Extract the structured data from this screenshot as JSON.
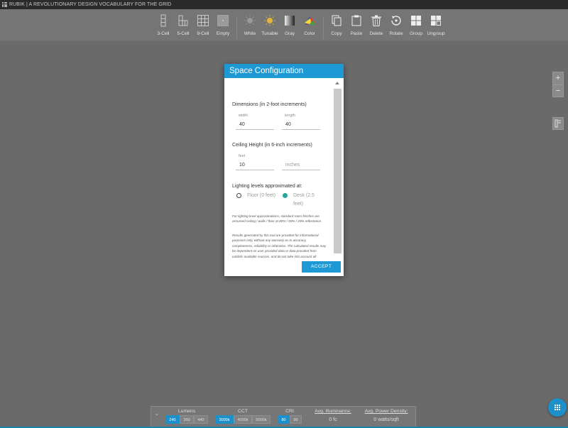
{
  "app": {
    "title": "RUBIK | A REVOLUTIONARY DESIGN VOCABULARY FOR THE GRID"
  },
  "toolbar": {
    "layouts": [
      "3-Cell",
      "5-Cell",
      "9-Cell",
      "Empty"
    ],
    "lighting": [
      "White",
      "Tunable",
      "Gray",
      "Color"
    ],
    "actions": [
      "Copy",
      "Paste",
      "Delete",
      "Rotate",
      "Group",
      "Ungroup"
    ]
  },
  "zoom": {
    "in": "+",
    "out": "−"
  },
  "dialog": {
    "title": "Space Configuration",
    "dimensions": {
      "heading": "Dimensions (in 2-foot increments)",
      "width_label": "width",
      "width_value": "40",
      "length_label": "length",
      "length_value": "40"
    },
    "ceiling": {
      "heading": "Ceiling Height (in 6-inch increments)",
      "feet_label": "feet",
      "feet_value": "10",
      "inches_placeholder": "inches"
    },
    "lighting": {
      "heading": "Lighting levels approximated at:",
      "floor_label": "Floor (0 feet)",
      "desk_label": "Desk (2.5 feet)",
      "selected": "desk"
    },
    "note1": "For lighting level approximations, standard room finishes are assumed ceiling / walls / floor at 80% / 50% / 20% reflectance.",
    "note2": "Results generated by this tool are provided for informational purposes only, without any warranty as to accuracy, completeness, reliability or otherwise. The calculated results may be dependent on user provided data or data provided from publicly available sources, and do not take into account all factors and circumstances. The Visual Support Center is available",
    "accept_label": "ACCEPT"
  },
  "bottom_bar": {
    "lumens": {
      "label": "Lumens",
      "options": [
        "240",
        "360",
        "440"
      ],
      "selected": "240"
    },
    "cct": {
      "label": "CCT",
      "options": [
        "3000k",
        "4000k",
        "5000k"
      ],
      "selected": "3000k"
    },
    "cri": {
      "label": "CRI",
      "options": [
        "80",
        "90"
      ],
      "selected": "80"
    },
    "illuminance": {
      "label": "Avg. Illuminance:",
      "value": "0 fc"
    },
    "power_density": {
      "label": "Avg. Power Density:",
      "value": "0 watts/sqft"
    }
  },
  "colors": {
    "accent": "#1d9ad6",
    "radio_selected": "#26a69a"
  }
}
